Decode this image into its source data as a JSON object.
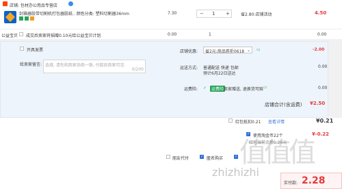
{
  "store": {
    "label": "店铺: 包材办公用品专营店"
  },
  "item": {
    "title": "封箱器胶带切割机打包器胶纸.. 颜色分类: 塑料切割器36mm",
    "price": "7.30",
    "quantity": "1",
    "discount": "省2.80:店铺活动",
    "subtotal": "4.50"
  },
  "service": {
    "label": "公益宝贝",
    "text": "成交后卖家将捐赠0.10元给公益宝贝计划",
    "price": "0.00",
    "qty": "1",
    "subtotal": "0.00"
  },
  "options": {
    "invoice_label": "开具发票",
    "coupon_label": "店铺优惠:",
    "coupon_value": "省2元:商品券折0618",
    "coupon_amount": "-2.00",
    "message_label": "给卖家留言:",
    "message_placeholder": "选填, 请先和商家协商一致, 付款后商家可见",
    "message_counter": "0/200",
    "shipping_label": "运送方式:",
    "shipping_value": "普通配送 快递 包邮",
    "shipping_date": "预计6月22日送达",
    "shipping_price": "0.00",
    "insurance_label": "运费险:",
    "insurance_tag": "运费险",
    "insurance_text": "卖家赠送, 退换货可赔",
    "insurance_price": "0.00",
    "store_total_label": "店铺合计(含运费)",
    "store_total": "¥2.50"
  },
  "summary": {
    "redpacket_label": "红包抵扣0.21",
    "redpacket_link": "查看详情",
    "redpacket_amount": "¥0.21",
    "tmall_label": "使用淘金币22个",
    "tmall_sub": "红包当前余额1.26元",
    "tmall_amount": "¥-0.22",
    "proxy_label": "朋友代付",
    "anonymous_label": "匿名购买",
    "pay_label": "实付款:",
    "pay_amount": "2.28"
  },
  "watermark": {
    "glyphs": "值值值",
    "url": "zhizhizhi"
  }
}
